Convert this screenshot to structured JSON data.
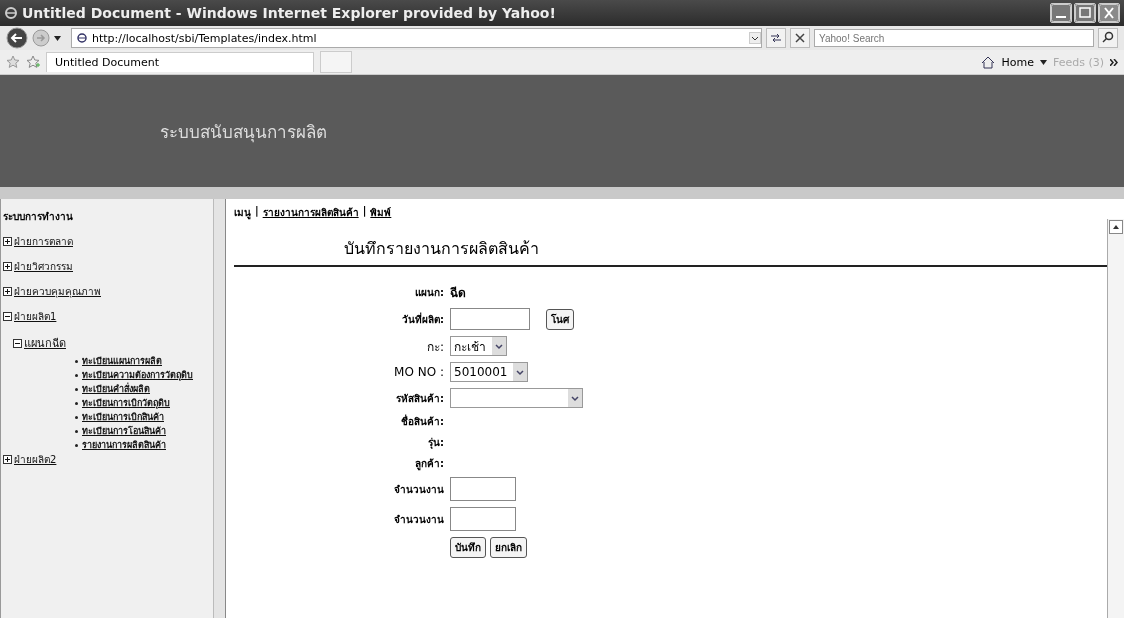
{
  "window": {
    "title": "Untitled Document - Windows Internet Explorer provided by Yahoo!"
  },
  "address_bar": {
    "value": "http://localhost/sbi/Templates/index.html"
  },
  "search": {
    "placeholder": "Yahoo! Search"
  },
  "tab": {
    "label": "Untitled Document"
  },
  "command_bar": {
    "home": "Home",
    "feeds": "Feeds (3)"
  },
  "header": {
    "title": "ระบบสนับสนุนการผลิต"
  },
  "sidebar": {
    "heading": "ระบบการทำงาน",
    "items": [
      {
        "label": "ฝ่ายการตลาด",
        "expanded": false
      },
      {
        "label": "ฝ่ายวิศวกรรม",
        "expanded": false
      },
      {
        "label": "ฝ่ายควบคุมคุณภาพ",
        "expanded": false
      },
      {
        "label": "ฝ่ายผลิต1",
        "expanded": true,
        "children": [
          {
            "label": "แผนกฉีด",
            "expanded": true,
            "children": [
              {
                "label": "ทะเบียนแผนการผลิต"
              },
              {
                "label": "ทะเบียนความต้องการวัตถุดิบ"
              },
              {
                "label": "ทะเบียนคำสั่งผลิต"
              },
              {
                "label": "ทะเบียนการเบิกวัตถุดิบ"
              },
              {
                "label": "ทะเบียนการเบิกสินค้า"
              },
              {
                "label": "ทะเบียนการโอนสินค้า"
              },
              {
                "label": "รายงานการผลิตสินค้า"
              }
            ]
          }
        ]
      },
      {
        "label": "ฝ่ายผลิต2",
        "expanded": false
      }
    ]
  },
  "breadcrumb": [
    {
      "label": "เมนู",
      "kind": "text"
    },
    {
      "label": "|",
      "kind": "separator"
    },
    {
      "label": "รายงานการผลิตสินค้า",
      "kind": "link"
    },
    {
      "label": "|",
      "kind": "separator"
    },
    {
      "label": "พิมพ์",
      "kind": "link"
    }
  ],
  "form": {
    "title": "บันทึกรายงานการผลิตสินค้า",
    "fields": [
      {
        "kind": "static",
        "label": "แผนก:",
        "value": "ฉีด"
      },
      {
        "kind": "date",
        "label": "วันที่ผลิต:",
        "button": "โนศ"
      },
      {
        "kind": "select",
        "label": "กะ:",
        "value": "กะเช้า"
      },
      {
        "kind": "select",
        "label": "MO NO :",
        "value": "5010001"
      },
      {
        "kind": "wideselect",
        "label": "รหัสสินค้า:"
      },
      {
        "kind": "static",
        "label": "ชื่อสินค้า:"
      },
      {
        "kind": "static",
        "label": "รุ่น:"
      },
      {
        "kind": "static",
        "label": "ลูกค้า:"
      },
      {
        "kind": "input",
        "label": "จำนวนงาน"
      },
      {
        "kind": "input",
        "label": "จำนวนงาน"
      }
    ],
    "buttons": [
      "บันทึก",
      "ยกเลิก"
    ]
  }
}
